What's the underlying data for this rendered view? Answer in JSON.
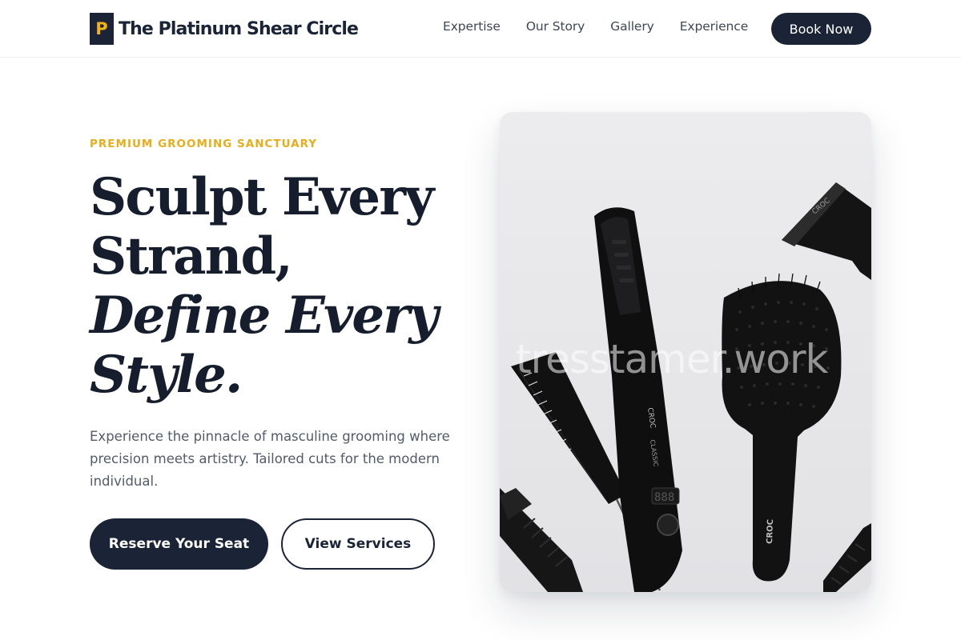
{
  "header": {
    "logo_letter": "P",
    "brand_name": "The Platinum Shear Circle",
    "nav": [
      {
        "label": "Expertise"
      },
      {
        "label": "Our Story"
      },
      {
        "label": "Gallery"
      },
      {
        "label": "Experience"
      }
    ],
    "cta_label": "Book Now"
  },
  "hero": {
    "eyebrow": "PREMIUM GROOMING SANCTUARY",
    "headline": {
      "line1": "Sculpt Every",
      "line2": "Strand,",
      "line3": "Define Every",
      "line4": "Style."
    },
    "description": "Experience the pinnacle of masculine grooming where precision meets artistry. Tailored cuts for the modern individual.",
    "primary_button": "Reserve Your Seat",
    "secondary_button": "View Services"
  },
  "image": {
    "watermark": "tresstamer.work",
    "brand_marks": [
      "CROC",
      "CROC",
      "CROC"
    ],
    "iron_label": "CLASSIC",
    "iron_display": "888"
  },
  "colors": {
    "primary": "#1b2436",
    "accent": "#e8ad1d",
    "text_muted": "#525b6b",
    "image_bg": "#e9e9eb"
  }
}
